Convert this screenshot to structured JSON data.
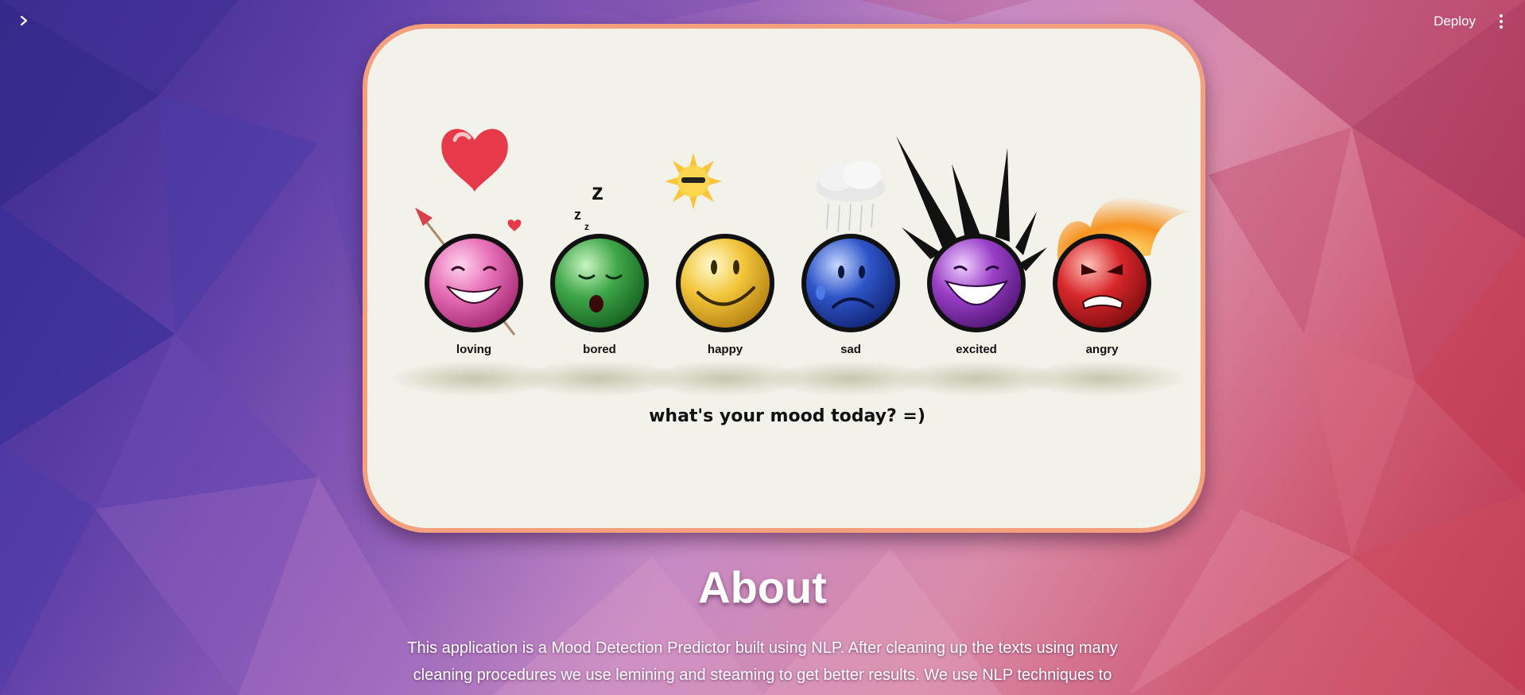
{
  "header": {
    "sidebar_toggle_icon": "chevron-right-icon",
    "deploy_label": "Deploy",
    "menu_icon": "kebab-menu-icon"
  },
  "hero": {
    "moods": [
      {
        "label": "loving",
        "color": "#e66fb6",
        "decoration": "heart-arrow"
      },
      {
        "label": "bored",
        "color": "#3fa64a",
        "decoration": "zzz"
      },
      {
        "label": "happy",
        "color": "#f2c53a",
        "decoration": "sun"
      },
      {
        "label": "sad",
        "color": "#2f55c9",
        "decoration": "rain-cloud"
      },
      {
        "label": "excited",
        "color": "#9a3fc6",
        "decoration": "spikes"
      },
      {
        "label": "angry",
        "color": "#d8282c",
        "decoration": "flame"
      }
    ],
    "tagline": "what's your mood today? =)"
  },
  "about": {
    "title": "About",
    "text": "This application is a Mood Detection Predictor built using NLP. After cleaning up the texts using many cleaning procedures we use lemining and steaming to get better results. We use NLP techniques to"
  }
}
